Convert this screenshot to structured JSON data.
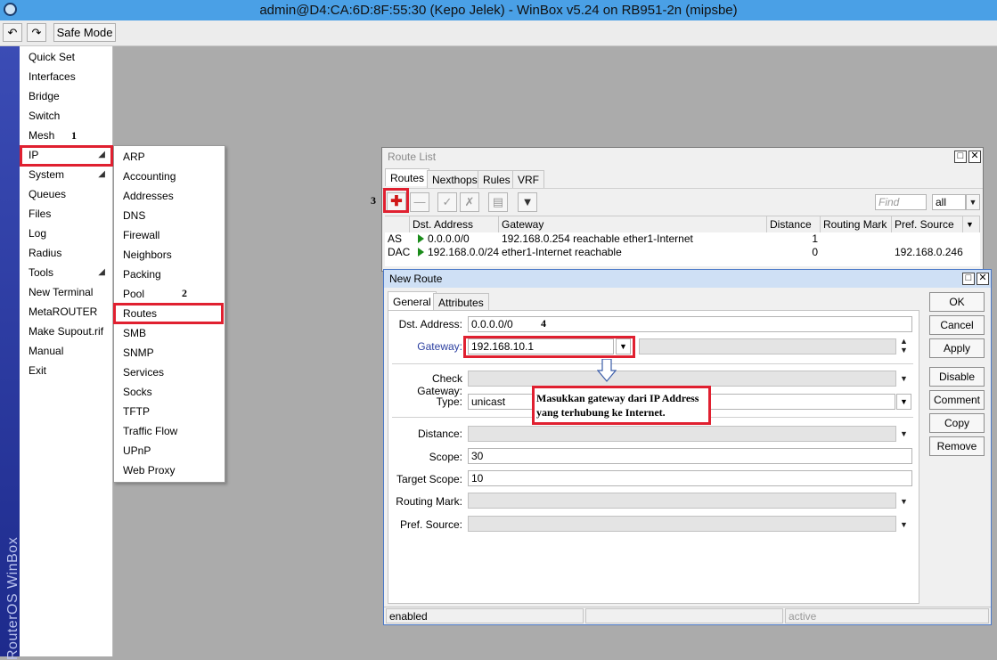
{
  "window_title": "admin@D4:CA:6D:8F:55:30 (Kepo Jelek) - WinBox v5.24 on RB951-2n (mipsbe)",
  "toolbar": {
    "undo_icon": "undo-icon",
    "redo_icon": "redo-icon",
    "safe_mode_label": "Safe Mode"
  },
  "side_strip_label": "RouterOS WinBox",
  "menu": {
    "items": [
      "Quick Set",
      "Interfaces",
      "Bridge",
      "Switch",
      "Mesh",
      "IP",
      "System",
      "Queues",
      "Files",
      "Log",
      "Radius",
      "Tools",
      "New Terminal",
      "MetaROUTER",
      "Make Supout.rif",
      "Manual",
      "Exit"
    ]
  },
  "submenu": {
    "items": [
      "ARP",
      "Accounting",
      "Addresses",
      "DNS",
      "Firewall",
      "Neighbors",
      "Packing",
      "Pool",
      "Routes",
      "SMB",
      "SNMP",
      "Services",
      "Socks",
      "TFTP",
      "Traffic Flow",
      "UPnP",
      "Web Proxy"
    ]
  },
  "annotations": {
    "step1": "1",
    "step2": "2",
    "step3": "3",
    "step4": "4",
    "callout_line1": "Masukkan gateway dari IP Address",
    "callout_line2": "yang terhubung ke Internet."
  },
  "route_list": {
    "title": "Route List",
    "tabs": [
      "Routes",
      "Nexthops",
      "Rules",
      "VRF"
    ],
    "find_placeholder": "Find",
    "filter_value": "all",
    "columns": [
      "Dst. Address",
      "Gateway",
      "Distance",
      "Routing Mark",
      "Pref. Source"
    ],
    "rows": [
      {
        "flags": "AS",
        "dst": "0.0.0.0/0",
        "gateway": "192.168.0.254 reachable ether1-Internet",
        "distance": "1",
        "mark": "",
        "pref": ""
      },
      {
        "flags": "DAC",
        "dst": "192.168.0.0/24",
        "gateway": "ether1-Internet reachable",
        "distance": "0",
        "mark": "",
        "pref": "192.168.0.246"
      }
    ]
  },
  "new_route": {
    "title": "New Route",
    "tabs": [
      "General",
      "Attributes"
    ],
    "labels": {
      "dst": "Dst. Address:",
      "gateway": "Gateway:",
      "check_gateway": "Check Gateway:",
      "type": "Type:",
      "distance": "Distance:",
      "scope": "Scope:",
      "target_scope": "Target Scope:",
      "routing_mark": "Routing Mark:",
      "pref_source": "Pref. Source:"
    },
    "values": {
      "dst": "0.0.0.0/0",
      "gateway": "192.168.10.1",
      "type": "unicast",
      "scope": "30",
      "target_scope": "10"
    },
    "buttons": [
      "OK",
      "Cancel",
      "Apply",
      "Disable",
      "Comment",
      "Copy",
      "Remove"
    ],
    "status": {
      "left": "enabled",
      "middle": "",
      "right": "active"
    }
  },
  "colors": {
    "highlight": "#e02030",
    "gateway_label": "#2b3fa0",
    "titlebar": "#4aa0e6"
  }
}
